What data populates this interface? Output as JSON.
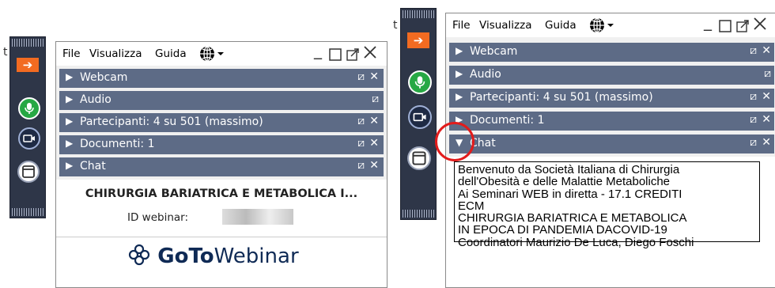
{
  "background_text": "t",
  "menu": {
    "file": "File",
    "view": "Visualizza",
    "help": "Guida"
  },
  "icons": {
    "globe": "globe-icon",
    "minimize": "minimize-icon",
    "maximize": "maximize-icon",
    "popout": "popout-icon",
    "close": "close-icon",
    "expand": "expand-triangle-icon",
    "collapse": "collapse-triangle-icon",
    "arrow": "arrow-right-icon",
    "mic": "microphone-icon",
    "camera": "webcam-icon",
    "window": "window-icon"
  },
  "colors": {
    "accent": "#f26b21",
    "mic_green": "#27a844",
    "row_bg": "#5d6b86",
    "highlight": "#e21b1b"
  },
  "panes": {
    "webcam": "Webcam",
    "audio": "Audio",
    "participants": "Partecipanti:  4 su 501 (massimo)",
    "documents": "Documenti: 1",
    "chat": "Chat"
  },
  "webinar": {
    "title": "CHIRURGIA BARIATRICA E METABOLICA I...",
    "id_label": "ID webinar:",
    "logo_bold": "GoTo",
    "logo_light": "Webinar"
  },
  "chat": {
    "lines": [
      "Benvenuto da Società Italiana di Chirurgia",
      "dell'Obesità e delle Malattie Metaboliche",
      "Ai Seminari WEB in diretta - 17.1 CREDITI",
      "ECM",
      "CHIRURGIA BARIATRICA E METABOLICA",
      "IN EPOCA DI PANDEMIA DACOVID-19",
      "Coordinatori Maurizio De Luca, Diego Foschi"
    ]
  }
}
